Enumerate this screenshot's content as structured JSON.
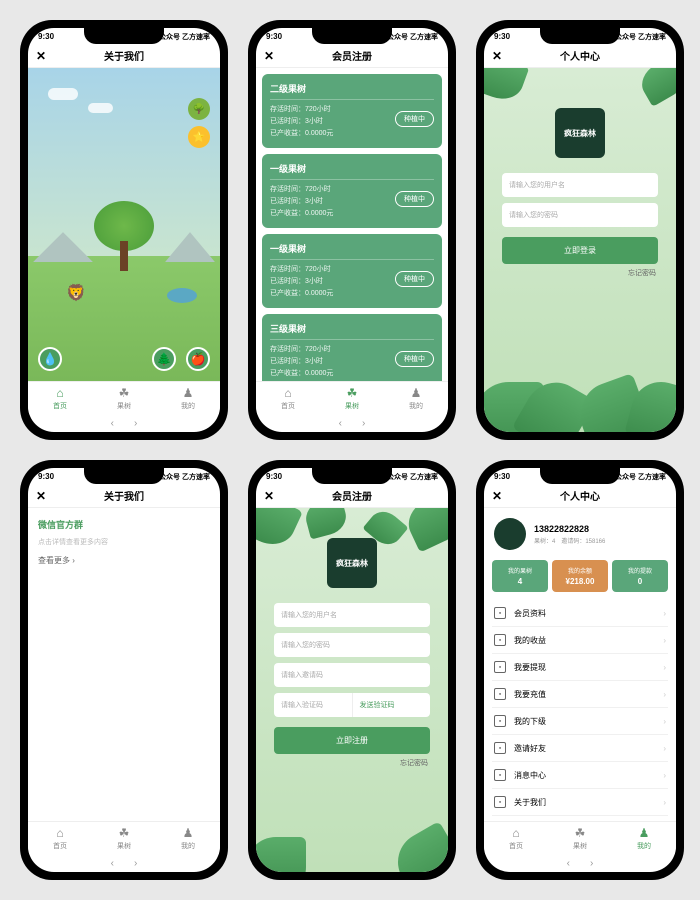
{
  "status": {
    "time": "9:30",
    "right": "公众号 乙方速率"
  },
  "screens": {
    "s1": {
      "title": "关于我们",
      "badges": [
        "领乐林",
        "收益"
      ],
      "btns": {
        "left": "浇水",
        "mid": "我的树木",
        "right": "植树产果"
      },
      "tabs": [
        {
          "l": "首页",
          "a": true
        },
        {
          "l": "果树"
        },
        {
          "l": "我的"
        }
      ]
    },
    "s2": {
      "title": "会员注册",
      "cards": [
        {
          "t": "二级果树",
          "r1": "存活时间：720小时",
          "r2": "已活时间：3小时",
          "r3": "已产收益：0.0000元",
          "b": "种植中"
        },
        {
          "t": "一级果树",
          "r1": "存活时间：720小时",
          "r2": "已活时间：3小时",
          "r3": "已产收益：0.0000元",
          "b": "种植中"
        },
        {
          "t": "一级果树",
          "r1": "存活时间：720小时",
          "r2": "已活时间：3小时",
          "r3": "已产收益：0.0000元",
          "b": "种植中"
        },
        {
          "t": "三级果树",
          "r1": "存活时间：720小时",
          "r2": "已活时间：3小时",
          "r3": "已产收益：0.0000元",
          "b": "种植中"
        }
      ],
      "tabs": [
        {
          "l": "首页"
        },
        {
          "l": "果树",
          "a": true
        },
        {
          "l": "我的"
        }
      ]
    },
    "s3": {
      "title": "个人中心",
      "logo": "疯狂森林",
      "p1": "请输入您的用户名",
      "p2": "请输入您的密码",
      "btn": "立即登录",
      "forgot": "忘记密码"
    },
    "s4": {
      "title": "关于我们",
      "h": "微信官方群",
      "sub": "点击详情查看更多内容",
      "more": "查看更多",
      "tabs": [
        {
          "l": "首页"
        },
        {
          "l": "果树"
        },
        {
          "l": "我的"
        }
      ]
    },
    "s5": {
      "title": "会员注册",
      "logo": "疯狂森林",
      "p1": "请输入您的用户名",
      "p2": "请输入您的密码",
      "p3": "请输入邀请码",
      "p4": "请输入验证码",
      "send": "发送验证码",
      "btn": "立即注册",
      "forgot": "忘记密码"
    },
    "s6": {
      "title": "个人中心",
      "name": "13822822828",
      "sub": "果树：4　邀请码：158166",
      "stats": [
        {
          "l": "我的果树",
          "v": "4",
          "c": "#5aa67a"
        },
        {
          "l": "我的余额",
          "v": "¥218.00",
          "c": "#d89050"
        },
        {
          "l": "我的提款",
          "v": "0",
          "c": "#5aa67a"
        }
      ],
      "menu": [
        "会员资料",
        "我的收益",
        "我要提现",
        "我要充值",
        "我的下级",
        "邀请好友",
        "消息中心",
        "关于我们"
      ],
      "tabs": [
        {
          "l": "首页"
        },
        {
          "l": "果树"
        },
        {
          "l": "我的",
          "a": true
        }
      ]
    }
  }
}
